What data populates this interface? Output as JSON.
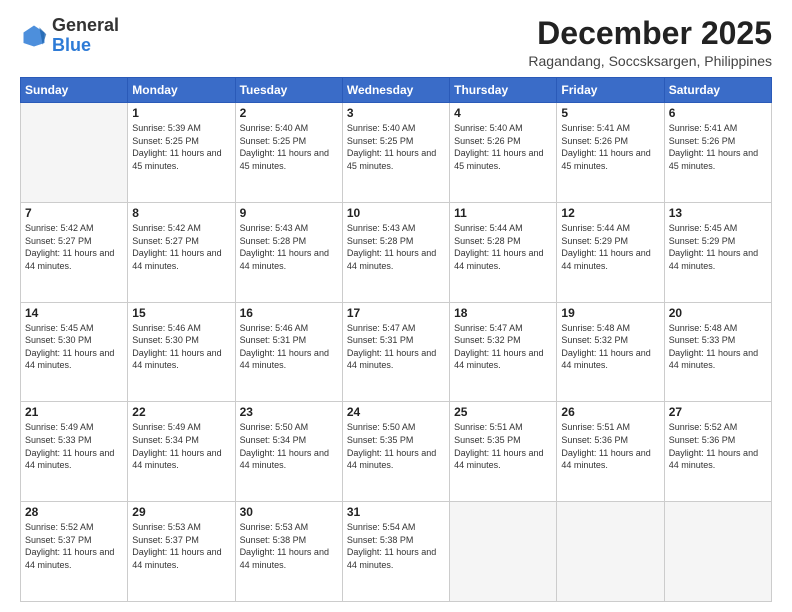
{
  "logo": {
    "general": "General",
    "blue": "Blue"
  },
  "header": {
    "month": "December 2025",
    "location": "Ragandang, Soccsksargen, Philippines"
  },
  "weekdays": [
    "Sunday",
    "Monday",
    "Tuesday",
    "Wednesday",
    "Thursday",
    "Friday",
    "Saturday"
  ],
  "weeks": [
    [
      {
        "day": "",
        "empty": true
      },
      {
        "day": "1",
        "sunrise": "5:39 AM",
        "sunset": "5:25 PM",
        "daylight": "11 hours and 45 minutes."
      },
      {
        "day": "2",
        "sunrise": "5:40 AM",
        "sunset": "5:25 PM",
        "daylight": "11 hours and 45 minutes."
      },
      {
        "day": "3",
        "sunrise": "5:40 AM",
        "sunset": "5:25 PM",
        "daylight": "11 hours and 45 minutes."
      },
      {
        "day": "4",
        "sunrise": "5:40 AM",
        "sunset": "5:26 PM",
        "daylight": "11 hours and 45 minutes."
      },
      {
        "day": "5",
        "sunrise": "5:41 AM",
        "sunset": "5:26 PM",
        "daylight": "11 hours and 45 minutes."
      },
      {
        "day": "6",
        "sunrise": "5:41 AM",
        "sunset": "5:26 PM",
        "daylight": "11 hours and 45 minutes."
      }
    ],
    [
      {
        "day": "7",
        "sunrise": "5:42 AM",
        "sunset": "5:27 PM",
        "daylight": "11 hours and 44 minutes."
      },
      {
        "day": "8",
        "sunrise": "5:42 AM",
        "sunset": "5:27 PM",
        "daylight": "11 hours and 44 minutes."
      },
      {
        "day": "9",
        "sunrise": "5:43 AM",
        "sunset": "5:28 PM",
        "daylight": "11 hours and 44 minutes."
      },
      {
        "day": "10",
        "sunrise": "5:43 AM",
        "sunset": "5:28 PM",
        "daylight": "11 hours and 44 minutes."
      },
      {
        "day": "11",
        "sunrise": "5:44 AM",
        "sunset": "5:28 PM",
        "daylight": "11 hours and 44 minutes."
      },
      {
        "day": "12",
        "sunrise": "5:44 AM",
        "sunset": "5:29 PM",
        "daylight": "11 hours and 44 minutes."
      },
      {
        "day": "13",
        "sunrise": "5:45 AM",
        "sunset": "5:29 PM",
        "daylight": "11 hours and 44 minutes."
      }
    ],
    [
      {
        "day": "14",
        "sunrise": "5:45 AM",
        "sunset": "5:30 PM",
        "daylight": "11 hours and 44 minutes."
      },
      {
        "day": "15",
        "sunrise": "5:46 AM",
        "sunset": "5:30 PM",
        "daylight": "11 hours and 44 minutes."
      },
      {
        "day": "16",
        "sunrise": "5:46 AM",
        "sunset": "5:31 PM",
        "daylight": "11 hours and 44 minutes."
      },
      {
        "day": "17",
        "sunrise": "5:47 AM",
        "sunset": "5:31 PM",
        "daylight": "11 hours and 44 minutes."
      },
      {
        "day": "18",
        "sunrise": "5:47 AM",
        "sunset": "5:32 PM",
        "daylight": "11 hours and 44 minutes."
      },
      {
        "day": "19",
        "sunrise": "5:48 AM",
        "sunset": "5:32 PM",
        "daylight": "11 hours and 44 minutes."
      },
      {
        "day": "20",
        "sunrise": "5:48 AM",
        "sunset": "5:33 PM",
        "daylight": "11 hours and 44 minutes."
      }
    ],
    [
      {
        "day": "21",
        "sunrise": "5:49 AM",
        "sunset": "5:33 PM",
        "daylight": "11 hours and 44 minutes."
      },
      {
        "day": "22",
        "sunrise": "5:49 AM",
        "sunset": "5:34 PM",
        "daylight": "11 hours and 44 minutes."
      },
      {
        "day": "23",
        "sunrise": "5:50 AM",
        "sunset": "5:34 PM",
        "daylight": "11 hours and 44 minutes."
      },
      {
        "day": "24",
        "sunrise": "5:50 AM",
        "sunset": "5:35 PM",
        "daylight": "11 hours and 44 minutes."
      },
      {
        "day": "25",
        "sunrise": "5:51 AM",
        "sunset": "5:35 PM",
        "daylight": "11 hours and 44 minutes."
      },
      {
        "day": "26",
        "sunrise": "5:51 AM",
        "sunset": "5:36 PM",
        "daylight": "11 hours and 44 minutes."
      },
      {
        "day": "27",
        "sunrise": "5:52 AM",
        "sunset": "5:36 PM",
        "daylight": "11 hours and 44 minutes."
      }
    ],
    [
      {
        "day": "28",
        "sunrise": "5:52 AM",
        "sunset": "5:37 PM",
        "daylight": "11 hours and 44 minutes."
      },
      {
        "day": "29",
        "sunrise": "5:53 AM",
        "sunset": "5:37 PM",
        "daylight": "11 hours and 44 minutes."
      },
      {
        "day": "30",
        "sunrise": "5:53 AM",
        "sunset": "5:38 PM",
        "daylight": "11 hours and 44 minutes."
      },
      {
        "day": "31",
        "sunrise": "5:54 AM",
        "sunset": "5:38 PM",
        "daylight": "11 hours and 44 minutes."
      },
      {
        "day": "",
        "empty": true
      },
      {
        "day": "",
        "empty": true
      },
      {
        "day": "",
        "empty": true
      }
    ]
  ],
  "labels": {
    "sunrise": "Sunrise:",
    "sunset": "Sunset:",
    "daylight": "Daylight:"
  }
}
